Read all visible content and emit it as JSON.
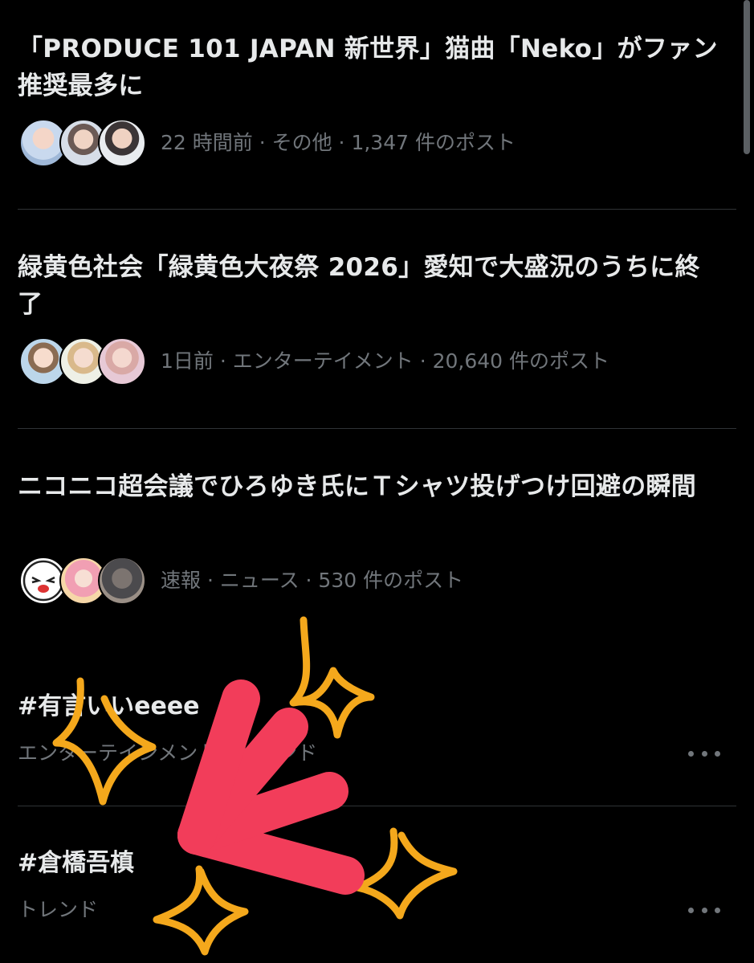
{
  "news": [
    {
      "title": "「PRODUCE 101 JAPAN 新世界」猫曲「Neko」がファン推奨最多に",
      "meta": "22 時間前 · その他 · 1,347 件のポスト"
    },
    {
      "title": "緑黄色社会「緑黄色大夜祭 2026」愛知で大盛況のうちに終了",
      "meta": "1日前 · エンターテイメント · 20,640 件のポスト"
    },
    {
      "title": "ニコニコ超会議でひろゆき氏にＴシャツ投げつけ回避の瞬間",
      "meta": "速報 · ニュース · 530 件のポスト"
    }
  ],
  "trends": [
    {
      "title": "#有言いいeeee",
      "subtitle": "エンターテインメント · トレンド"
    },
    {
      "title": "#倉橋吾槙",
      "subtitle": "トレンド"
    }
  ],
  "colors": {
    "background": "#000000",
    "text_primary": "#e7e9ea",
    "text_secondary": "#71767b",
    "divider": "#2f3336",
    "arrow_red": "#f23d5a",
    "sparkle_orange": "#f4a81c"
  },
  "icons": {
    "more": "more-horizontal-icon"
  }
}
